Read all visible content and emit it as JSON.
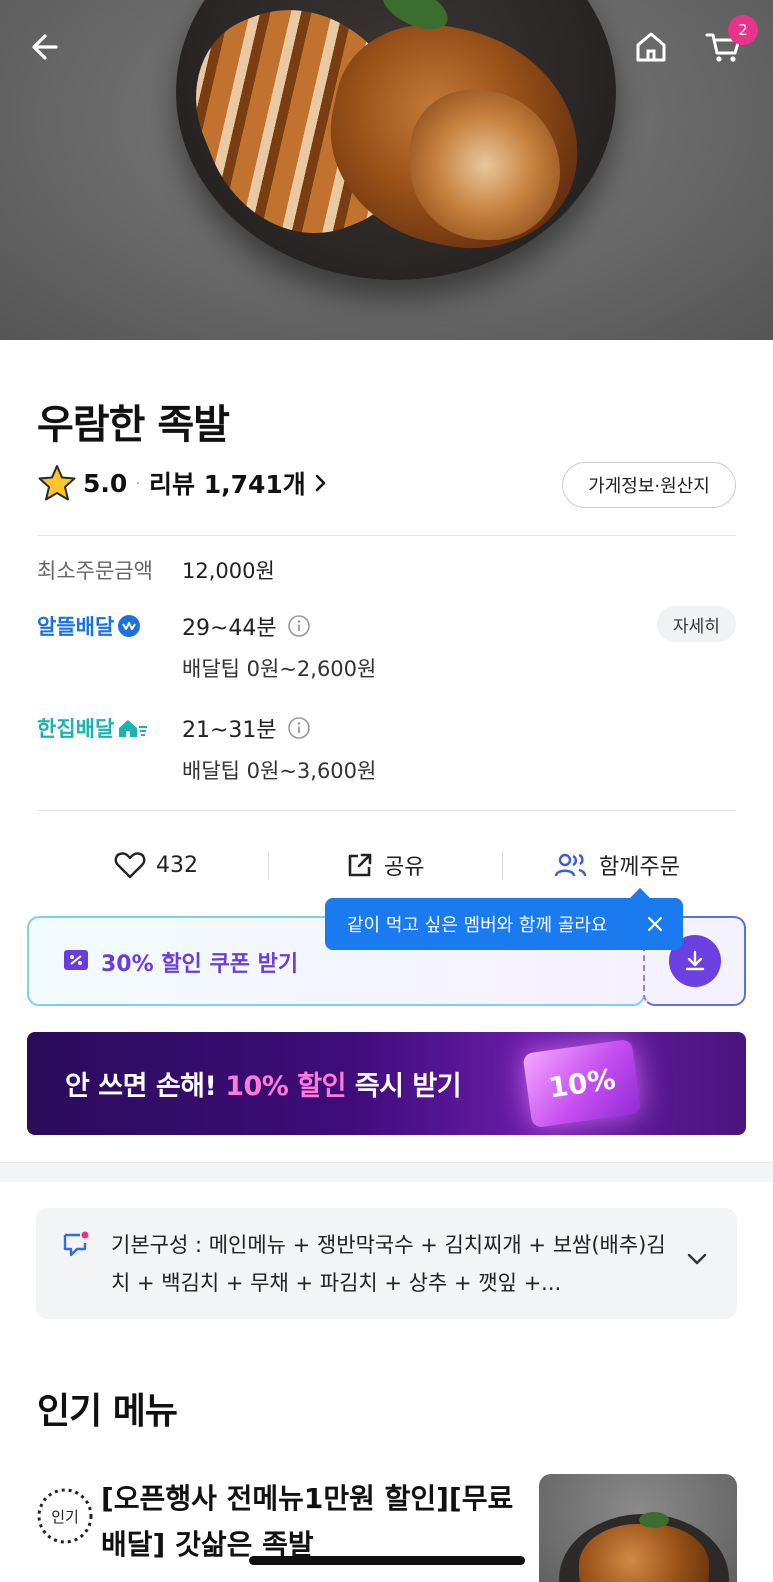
{
  "header": {
    "cart_count": "2"
  },
  "store": {
    "name": "우람한 족발",
    "rating": "5.0",
    "dot": "·",
    "review_label": "리뷰 1,741개",
    "info_button": "가게정보·원산지"
  },
  "order_info": {
    "min_order_label": "최소주문금액",
    "min_order_value": "12,000원",
    "detail_button": "자세히",
    "delivery_options": [
      {
        "name": "알뜰배달",
        "time": "29~44분",
        "tip": "배달팁 0원~2,600원"
      },
      {
        "name": "한집배달",
        "time": "21~31분",
        "tip": "배달팁 0원~3,600원"
      }
    ]
  },
  "actions": {
    "like_count": "432",
    "share_label": "공유",
    "group_order_label": "함께주문"
  },
  "tooltip": {
    "text": "같이 먹고 싶은 멤버와 함께 골라요"
  },
  "coupon": {
    "label": "30% 할인 쿠폰 받기"
  },
  "banner": {
    "text_before": "안 쓰면 손해! ",
    "text_highlight": "10% 할인",
    "text_after": " 즉시 받기",
    "ticket_label": "10%"
  },
  "basic_composition": {
    "text": "기본구성 : 메인메뉴 + 쟁반막국수 + 김치찌개 + 보쌈(배추)김치 + 백김치 + 무채 + 파김치 + 상추 + 깻잎 +..."
  },
  "popular_menu": {
    "title": "인기 메뉴",
    "items": [
      {
        "badge": "인기",
        "name": "[오픈행사 전메뉴1만원 할인][무료배달] 갓삶은 족발"
      }
    ]
  },
  "colors": {
    "altteul": "#1d72d8",
    "hanjip": "#1ab3b0",
    "coupon_purple": "#6a3fd9",
    "tooltip_blue": "#1a7af0",
    "badge_pink": "#e8338b",
    "banner_highlight": "#ff7ad9"
  }
}
